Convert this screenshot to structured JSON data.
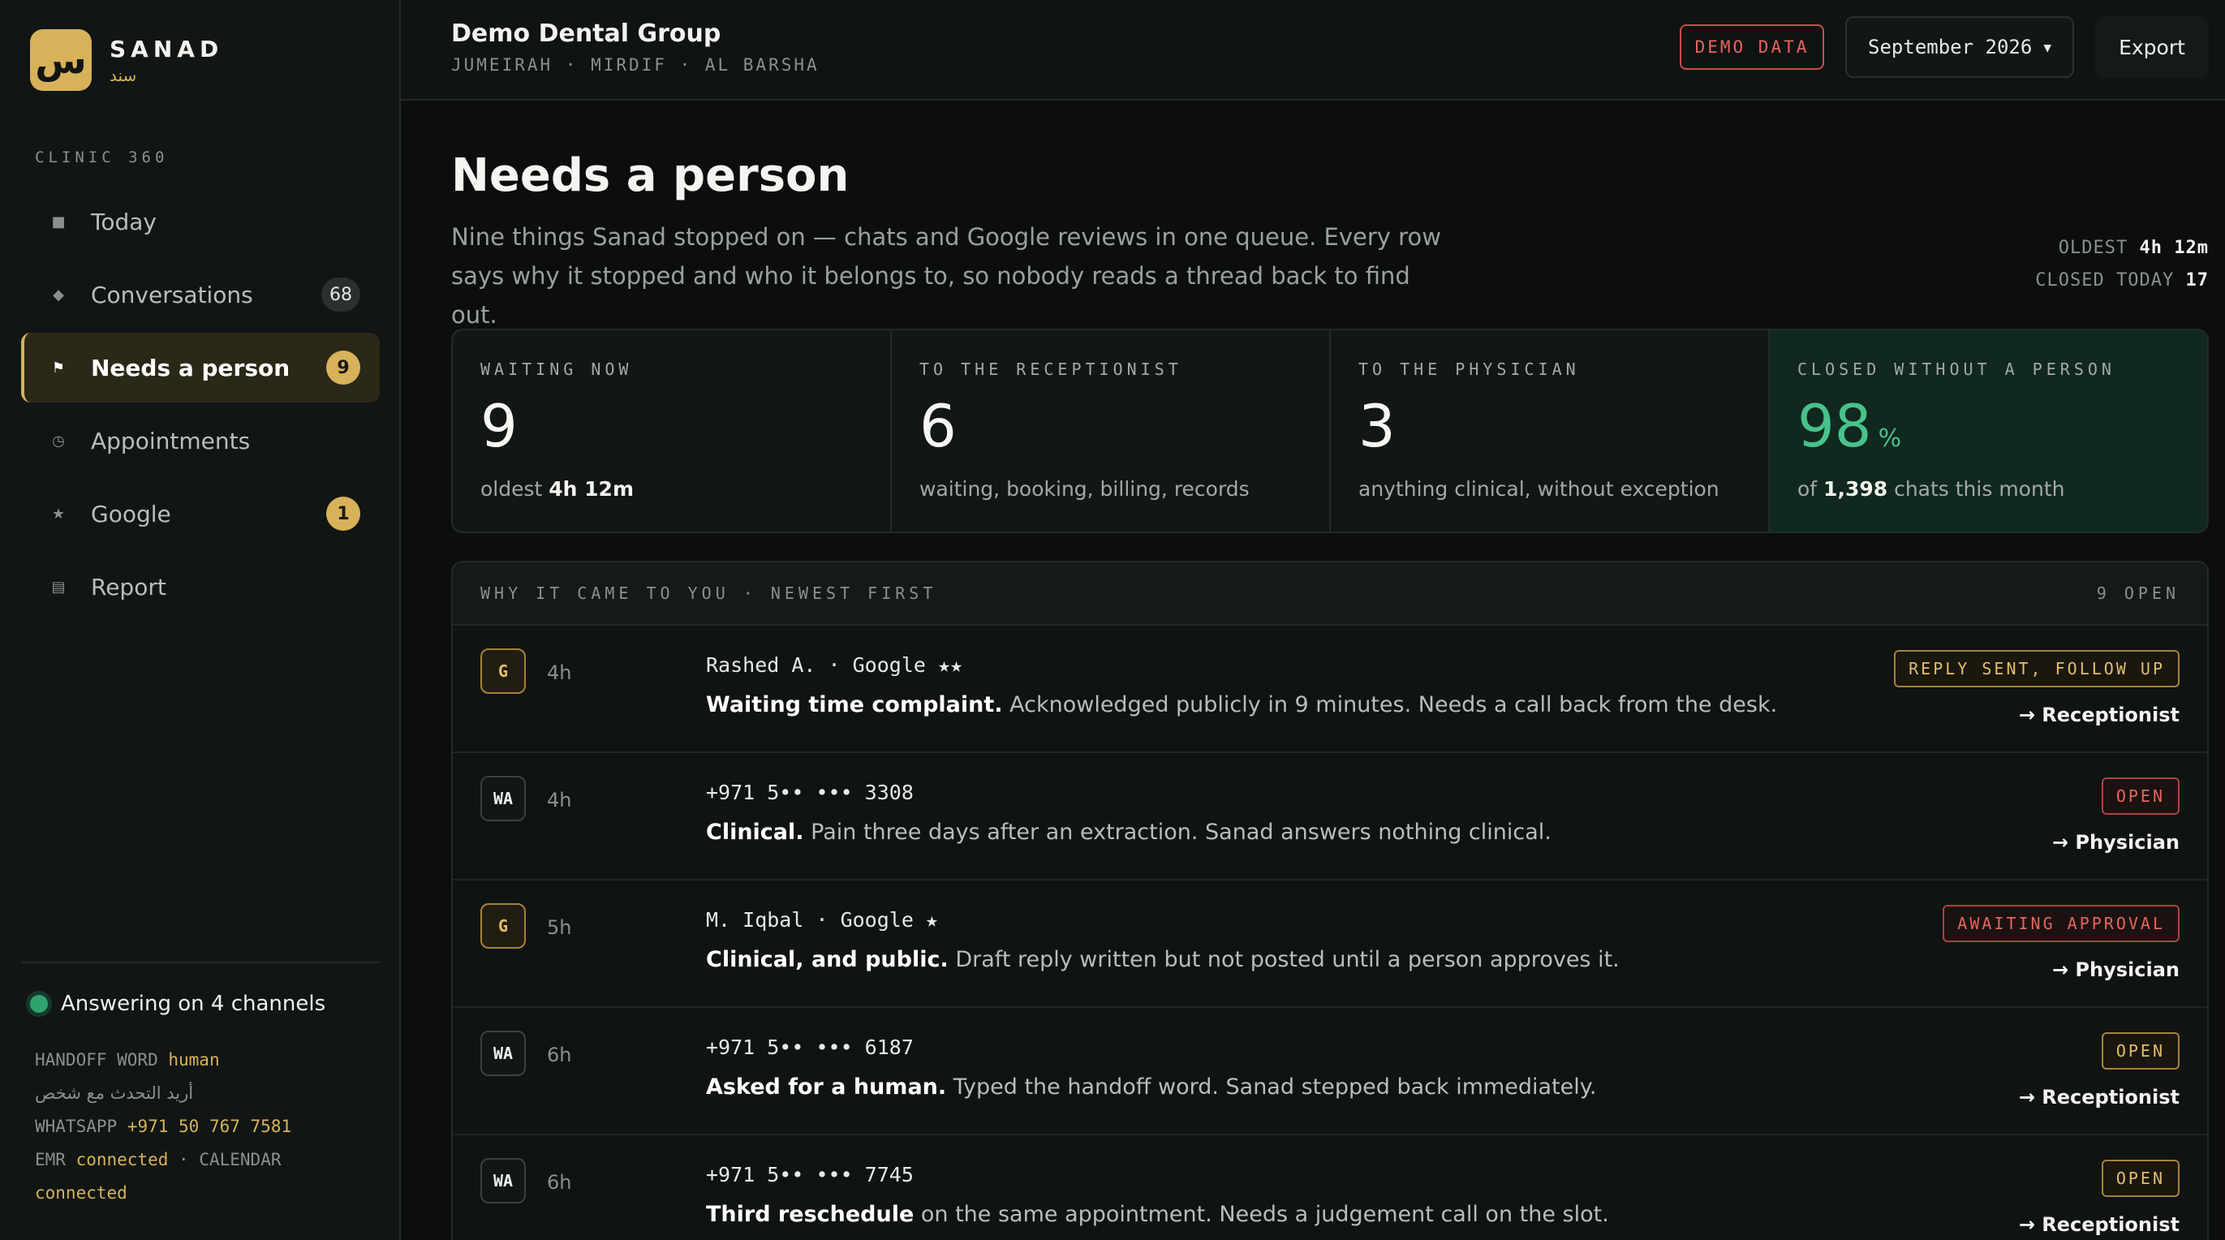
{
  "brand": {
    "glyph": "س",
    "name": "SANAD",
    "name_ar": "سند"
  },
  "sidebar": {
    "section": "CLINIC 360",
    "items": [
      {
        "icon": "■",
        "label": "Today",
        "badge": ""
      },
      {
        "icon": "◆",
        "label": "Conversations",
        "badge": "68"
      },
      {
        "icon": "⚑",
        "label": "Needs a person",
        "badge": "9"
      },
      {
        "icon": "◷",
        "label": "Appointments",
        "badge": ""
      },
      {
        "icon": "★",
        "label": "Google",
        "badge": "1"
      },
      {
        "icon": "▤",
        "label": "Report",
        "badge": ""
      }
    ],
    "status": "Answering on 4 channels",
    "handoff_label": "HANDOFF WORD",
    "handoff_value": "human",
    "handoff_ar": "أريد التحدث مع شخص",
    "whatsapp_label": "WHATSAPP",
    "whatsapp_value": "+971 50 767 7581",
    "emr_label": "EMR",
    "emr_value": "connected",
    "calendar_label": "CALENDAR",
    "calendar_value": "connected"
  },
  "topbar": {
    "org": "Demo Dental Group",
    "locations": "JUMEIRAH · MIRDIF · AL BARSHA",
    "demo": "DEMO DATA",
    "month": "September 2026",
    "export": "Export"
  },
  "main": {
    "title": "Needs a person",
    "description": "Nine things Sanad stopped on — chats and Google reviews in one queue. Every row says why it stopped and who it belongs to, so nobody reads a thread back to find out.",
    "oldest_label": "OLDEST",
    "oldest_value": "4h 12m",
    "closed_label": "CLOSED TODAY",
    "closed_value": "17"
  },
  "kpis": [
    {
      "label": "WAITING NOW",
      "value": "9",
      "note_pre": "oldest ",
      "note_bold": "4h 12m",
      "note_post": ""
    },
    {
      "label": "TO THE RECEPTIONIST",
      "value": "6",
      "note_pre": "waiting, booking, billing, records",
      "note_bold": "",
      "note_post": ""
    },
    {
      "label": "TO THE PHYSICIAN",
      "value": "3",
      "note_pre": "anything clinical, without exception",
      "note_bold": "",
      "note_post": ""
    },
    {
      "label": "CLOSED WITHOUT A PERSON",
      "value": "98",
      "unit": "%",
      "note_pre": "of ",
      "note_bold": "1,398",
      "note_post": " chats this month"
    }
  ],
  "queue": {
    "heading": "WHY IT CAME TO YOU · NEWEST FIRST",
    "count": "9 OPEN",
    "rows": [
      {
        "channel": "G",
        "age": "4h",
        "who": "Rashed A. · Google ★★",
        "bold": "Waiting time complaint.",
        "rest": " Acknowledged publicly in 9 minutes. Needs a call back from the desk.",
        "status": "REPLY SENT, FOLLOW UP",
        "owner": "→ Receptionist"
      },
      {
        "channel": "WA",
        "age": "4h",
        "who": "+971 5•• ••• 3308",
        "bold": "Clinical.",
        "rest": " Pain three days after an extraction. Sanad answers nothing clinical.",
        "status": "OPEN",
        "owner": "→ Physician"
      },
      {
        "channel": "G",
        "age": "5h",
        "who": "M. Iqbal · Google ★",
        "bold": "Clinical, and public.",
        "rest": " Draft reply written but not posted until a person approves it.",
        "status": "AWAITING APPROVAL",
        "owner": "→ Physician"
      },
      {
        "channel": "WA",
        "age": "6h",
        "who": "+971 5•• ••• 6187",
        "bold": "Asked for a human.",
        "rest": " Typed the handoff word. Sanad stepped back immediately.",
        "status": "OPEN",
        "owner": "→ Receptionist"
      },
      {
        "channel": "WA",
        "age": "6h",
        "who": "+971 5•• ••• 7745",
        "bold": "Third reschedule",
        "rest": " on the same appointment. Needs a judgement call on the slot.",
        "status": "OPEN",
        "owner": "→ Receptionist"
      }
    ]
  },
  "colors": {
    "accent": "#d7b25a",
    "green": "#48c28b",
    "red": "#e4665e",
    "bg": "#0b0e0d"
  }
}
